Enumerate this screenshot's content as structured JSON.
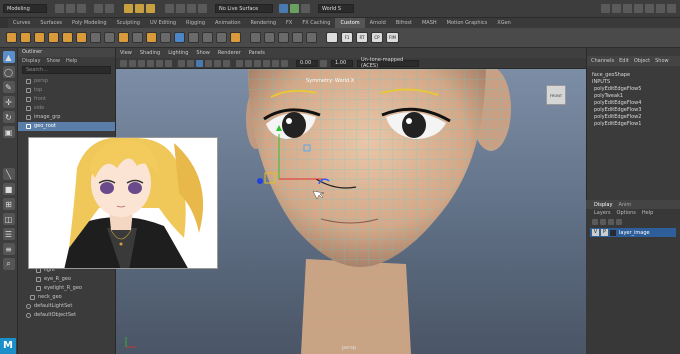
{
  "status_bar": {
    "mode_dropdown": "Modeling",
    "live_surface": "No Live Surface",
    "world_dropdown": "World S"
  },
  "shelf_tabs": [
    "Curves",
    "Surfaces",
    "Poly Modeling",
    "Sculpting",
    "UV Editing",
    "Rigging",
    "Animation",
    "Rendering",
    "FX",
    "FX Caching",
    "Custom",
    "Arnold",
    "Bifrost",
    "MASH",
    "Motion Graphics",
    "XGen"
  ],
  "shelf_active_tab": "Custom",
  "shelf_buttons": [
    "F1",
    "RT",
    "CP",
    "FIM"
  ],
  "outliner": {
    "title": "Outliner",
    "menu": [
      "Display",
      "Show",
      "Help"
    ],
    "search_placeholder": "Search...",
    "items_top": [
      "persp",
      "top",
      "front",
      "side",
      "image_grp",
      "geo_root"
    ],
    "items_bottom": [
      "light",
      "eye_R_geo",
      "eyelight_R_geo",
      "neck_geo",
      "defaultLightSet",
      "defaultObjectSet"
    ]
  },
  "viewport": {
    "menu": [
      "View",
      "Shading",
      "Lighting",
      "Show",
      "Renderer",
      "Panels"
    ],
    "symmetry_label": "Symmetry: World X",
    "camera_label": "persp",
    "cube_label": "FRONT",
    "field_value_1": "0.00",
    "field_value_2": "1.00",
    "colorspace": "Un-tone-mapped (ACES)"
  },
  "channel_box": {
    "menu": [
      "Channels",
      "Edit",
      "Object",
      "Show"
    ],
    "shape": "face_geoShape",
    "inputs_label": "INPUTS",
    "inputs": [
      "polyEditEdgeFlow5",
      "polyTweak1",
      "polyEditEdgeFlow4",
      "polyEditEdgeFlow3",
      "polyEditEdgeFlow2",
      "polyEditEdgeFlow1"
    ]
  },
  "layer_editor": {
    "tabs": [
      "Display",
      "Anim"
    ],
    "menu": [
      "Layers",
      "Options",
      "Help"
    ],
    "layer_v": "V",
    "layer_p": "P",
    "layer_name": "layer_image"
  },
  "logo_text": "M"
}
